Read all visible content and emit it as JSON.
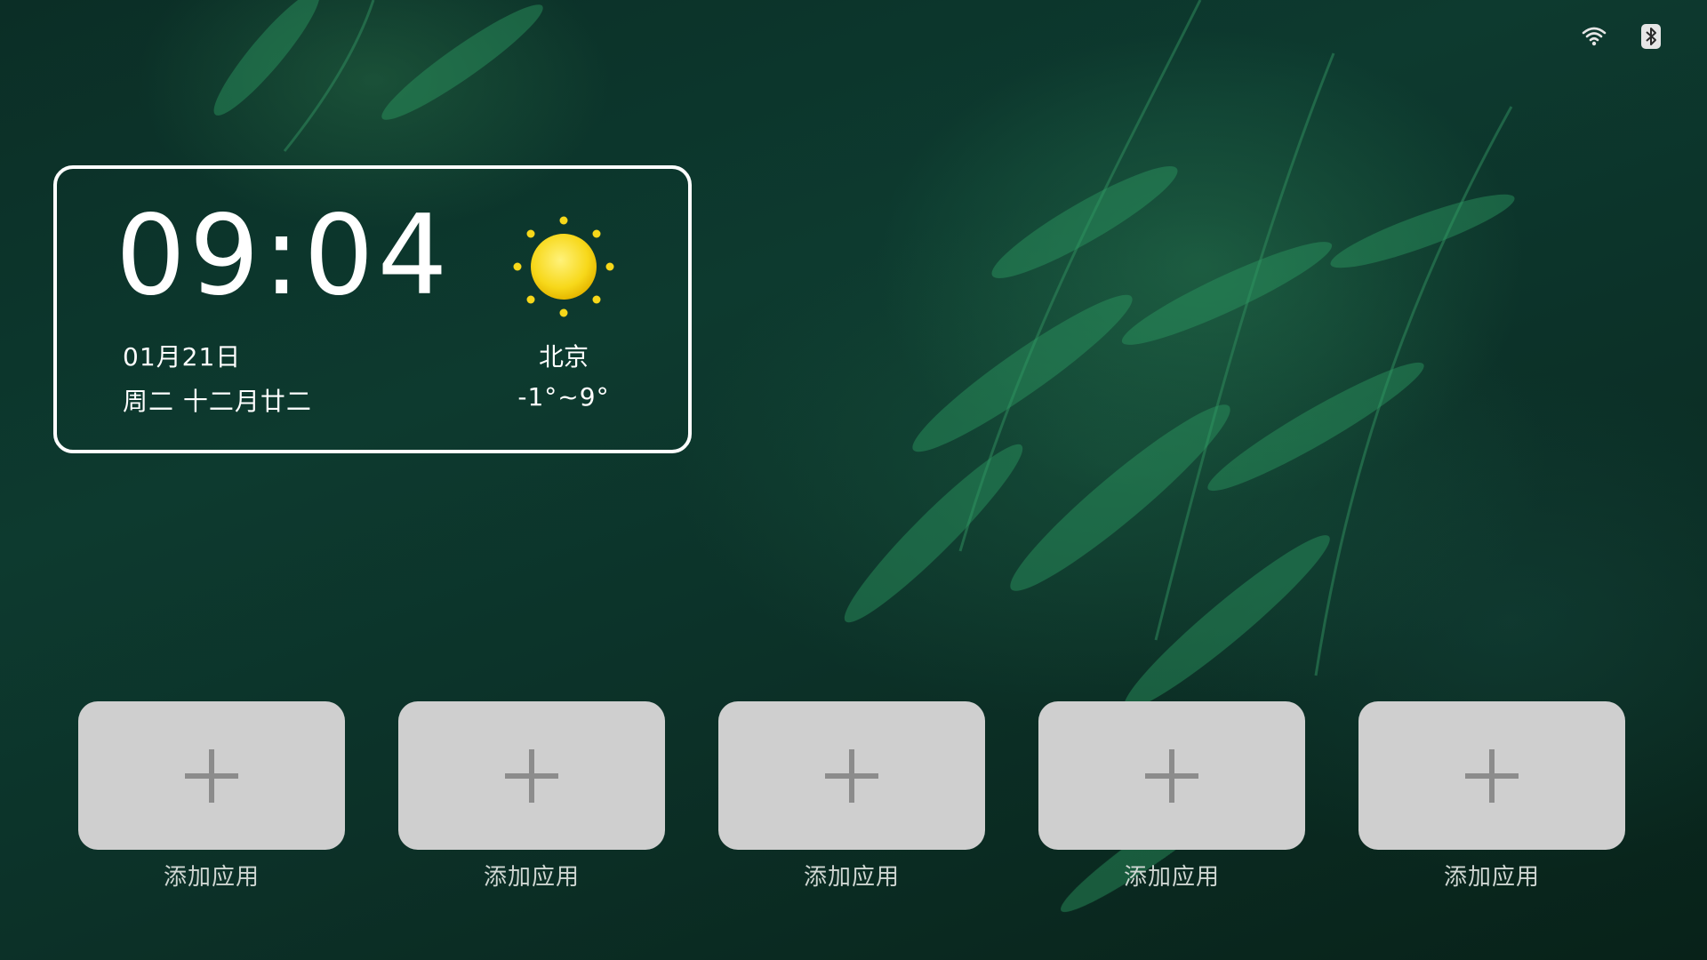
{
  "status": {
    "icons": [
      "wifi-icon",
      "bluetooth-icon"
    ]
  },
  "clock_card": {
    "time": "09:04",
    "date": "01月21日",
    "weekday_lunar": "周二  十二月廿二",
    "weather_icon": "sun-icon",
    "city": "北京",
    "temperature": "-1°~9°"
  },
  "apps": [
    {
      "label": "添加应用",
      "icon": "plus-icon"
    },
    {
      "label": "添加应用",
      "icon": "plus-icon"
    },
    {
      "label": "添加应用",
      "icon": "plus-icon"
    },
    {
      "label": "添加应用",
      "icon": "plus-icon"
    },
    {
      "label": "添加应用",
      "icon": "plus-icon"
    }
  ],
  "colors": {
    "tile_bg": "#cfcfcf",
    "plus": "#8c8c8c",
    "sun": "#f7d81a"
  }
}
